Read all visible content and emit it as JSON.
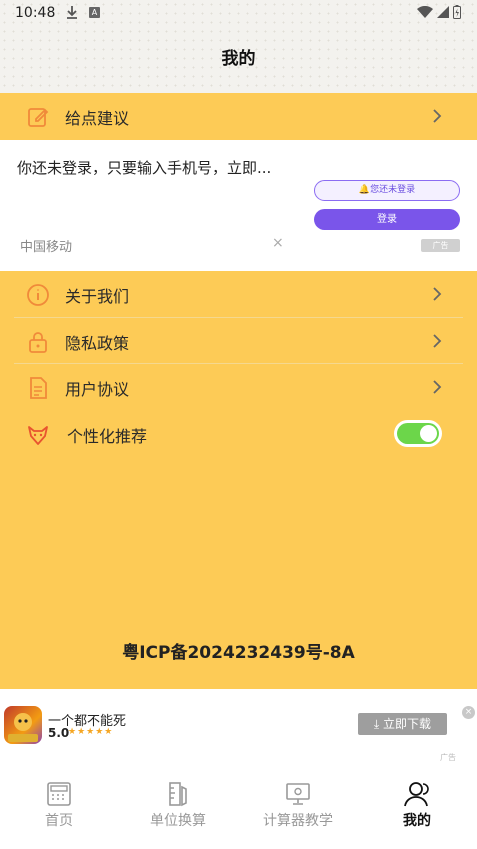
{
  "status_bar": {
    "time": "10:48",
    "a_badge": "A"
  },
  "header": {
    "title": "我的"
  },
  "menu": {
    "feedback": "给点建议",
    "about": "关于我们",
    "privacy": "隐私政策",
    "agreement": "用户协议",
    "personalized": "个性化推荐",
    "personalized_enabled": true
  },
  "ad_login": {
    "text": "你还未登录，只要输入手机号，立即...",
    "status_button": "您还未登录",
    "login_button": "登录",
    "carrier": "中国移动",
    "close": "×",
    "badge": "广告"
  },
  "footer": {
    "icp": "粤ICP备2024232439号-8A"
  },
  "ad_app": {
    "title": "一个都不能死",
    "rating": "5.0",
    "stars": "★★★★★",
    "download_button": "立即下载",
    "close": "×",
    "badge": "广告"
  },
  "tabs": [
    {
      "label": "首页",
      "icon": "calculator-icon"
    },
    {
      "label": "单位换算",
      "icon": "ruler-icon"
    },
    {
      "label": "计算器教学",
      "icon": "monitor-icon"
    },
    {
      "label": "我的",
      "icon": "user-icon"
    }
  ],
  "colors": {
    "accent_yellow": "#fdcb56",
    "icon_orange": "#f08a3a",
    "toggle_green": "#6cd64a",
    "ad_purple": "#7a55ea"
  }
}
